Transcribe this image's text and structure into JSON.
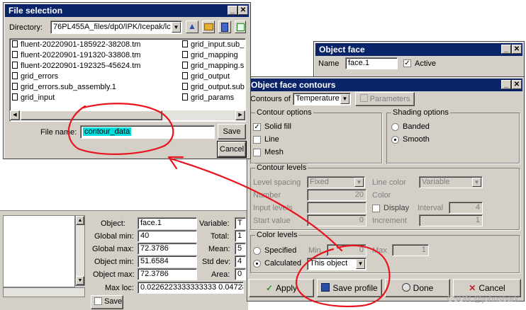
{
  "file_selection": {
    "title": "File selection",
    "directory_label": "Directory:",
    "directory_value": "76PL455A_files/dp0/IPK/Icepak/lc",
    "files_col1": [
      "fluent-20220901-185922-38208.tm",
      "fluent-20220901-191320-33808.tm",
      "fluent-20220901-192325-45624.tm",
      "grid_errors",
      "grid_errors.sub_assembly.1",
      "grid_input"
    ],
    "files_col2": [
      "grid_input.sub_a",
      "grid_mapping",
      "grid_mapping.s",
      "grid_output",
      "grid_output.sub",
      "grid_params"
    ],
    "file_name_label": "File name:",
    "file_name_value": "contour_data",
    "save_label": "Save",
    "cancel_label": "Cancel"
  },
  "object_face": {
    "title": "Object face",
    "name_label": "Name",
    "name_value": "face.1",
    "active_label": "Active"
  },
  "contours": {
    "title": "Object face contours",
    "contours_of_label": "Contours of",
    "contours_of_value": "Temperature",
    "parameters_label": "Parameters",
    "contour_options_label": "Contour options",
    "solid_fill_label": "Solid fill",
    "line_label": "Line",
    "mesh_label": "Mesh",
    "shading_options_label": "Shading options",
    "banded_label": "Banded",
    "smooth_label": "Smooth",
    "contour_levels_label": "Contour levels",
    "level_spacing_label": "Level spacing",
    "level_spacing_value": "Fixed",
    "line_color_label": "Line color",
    "line_color_value": "Variable",
    "number_label": "Number",
    "number_value": "20",
    "color_label": "Color",
    "input_levels_label": "Input levels",
    "display_label": "Display",
    "interval_label": "Interval",
    "interval_value": "4",
    "start_value_label": "Start value",
    "start_value_value": "0",
    "increment_label": "Increment",
    "increment_value": "1",
    "color_levels_label": "Color levels",
    "specified_label": "Specified",
    "calculated_label": "Calculated",
    "min_label": "Min",
    "min_value": "0",
    "max_label": "Max",
    "max_value": "1",
    "calc_value": "This object",
    "apply_label": "Apply",
    "save_profile_label": "Save profile",
    "done_label": "Done",
    "cancel_label": "Cancel"
  },
  "stats": {
    "object_label": "Object:",
    "object_value": "face.1",
    "global_min_label": "Global min:",
    "global_min_value": "40",
    "global_max_label": "Global max:",
    "global_max_value": "72.3786",
    "object_min_label": "Object min:",
    "object_min_value": "51.6584",
    "object_max_label": "Object max:",
    "object_max_value": "72.3786",
    "max_loc_label": "Max loc:",
    "max_loc_value": "0.0226223333333333 0.0472882",
    "variable_label": "Variable:",
    "variable_value": "T",
    "total_label": "Total:",
    "total_value": "1",
    "mean_label": "Mean:",
    "mean_value": "5",
    "std_dev_label": "Std dev:",
    "std_dev_value": "4",
    "area_label": "Area:",
    "area_value": "0",
    "save_label": "Save"
  },
  "watermark": "CSDN @johnsbark",
  "annotation_color": "#e8141e"
}
